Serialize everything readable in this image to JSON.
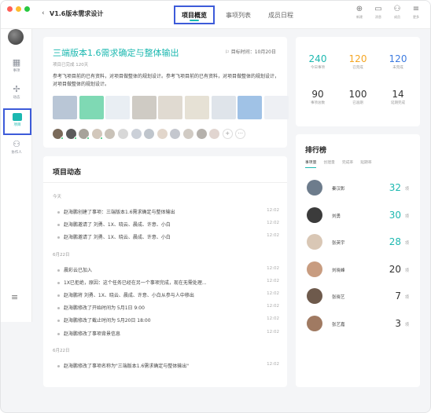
{
  "window": {
    "back_glyph": "‹",
    "project_title": "V1.6版本需求设计"
  },
  "tabs": [
    {
      "label": "项目概览",
      "active": true
    },
    {
      "label": "事项列表",
      "active": false
    },
    {
      "label": "成员日程",
      "active": false
    }
  ],
  "top_actions": [
    {
      "icon": "plus-circle-icon",
      "glyph": "⊕",
      "label": "新建"
    },
    {
      "icon": "message-icon",
      "glyph": "▭",
      "label": "消息"
    },
    {
      "icon": "user-icon",
      "glyph": "⚇",
      "label": "成员"
    },
    {
      "icon": "menu-icon",
      "glyph": "≡",
      "label": "更多"
    }
  ],
  "sidebar": {
    "items": [
      {
        "icon": "calendar-icon",
        "glyph": "▦",
        "label": "事项"
      },
      {
        "icon": "activity-icon",
        "glyph": "✢",
        "label": "动态"
      },
      {
        "icon": "folder-icon",
        "glyph": "",
        "label": "项目"
      },
      {
        "icon": "collaborator-icon",
        "glyph": "⚇",
        "label": "协作人"
      }
    ],
    "menu_glyph": "≡"
  },
  "project": {
    "name": "三端版本1.6需求确定与整体输出",
    "deadline": "目标时间：10月20日",
    "deadline_glyph": "⚐",
    "sub": "项目已完成 120天",
    "description": "参考飞项目前的已有资料，对项目做整体的规划设计。参考飞项目前的已有资料，对项目做整体的规划设计，对项目做整体的规划设计。",
    "thumb_colors": [
      "#b9c6d6",
      "#7fd9b4",
      "#e9eef3",
      "#cfcbc4",
      "#e0dad1",
      "#e6e1d5",
      "#dfe4ea",
      "#a0c2e6",
      "#eef0f4"
    ],
    "member_colors": [
      "#7a6a5a",
      "#5b5b5b",
      "#a7a29a",
      "#d2c7bb",
      "#c9c2b8",
      "#d8d8d8",
      "#cbd0d8",
      "#bfc5cc",
      "#e2d6cb",
      "#c4c7ce",
      "#d1cbc4",
      "#b5b1ac",
      "#e1d5d0"
    ],
    "member_add_glyph": "+",
    "member_more_glyph": "···"
  },
  "stats": [
    {
      "value": "240",
      "label": "今日事项",
      "color": "#1cb8b0"
    },
    {
      "value": "120",
      "label": "已完成",
      "color": "#f5a623"
    },
    {
      "value": "120",
      "label": "未完成",
      "color": "#3d7be0"
    },
    {
      "value": "90",
      "label": "事项总数",
      "color": "#333333"
    },
    {
      "value": "100",
      "label": "已逾期",
      "color": "#333333"
    },
    {
      "value": "14",
      "label": "延期完成",
      "color": "#333333"
    }
  ],
  "activity": {
    "title": "项目动态",
    "groups": [
      {
        "label": "今天",
        "rows": [
          {
            "text": "赵海鹏创建了事项：三端版本1.6需求确定与整体输出",
            "time": "12:02"
          },
          {
            "text": "赵海鹏邀请了 刘勇、1X、晓云、晨成、许意、小白",
            "time": "12:02"
          },
          {
            "text": "赵海鹏邀请了 刘勇、1X、晓云、晨成、许意、小白",
            "time": "12:02"
          }
        ]
      },
      {
        "label": "6月22日",
        "rows": [
          {
            "text": "晨彩云已加入",
            "time": "12:02"
          },
          {
            "text": "1X已拒绝，原因：这个任务已经在另一个事项完成，现在无需处理...",
            "time": "12:02"
          },
          {
            "text": "赵海鹏将 刘勇、1X、晓云、晨成、许意、小白从参与人中移出",
            "time": "12:02"
          },
          {
            "text": "赵海鹏修改了开始时间为 5月1日 9:00",
            "time": "12:02"
          },
          {
            "text": "赵海鹏修改了截止时间为 5月20日 18:00",
            "time": "12:02"
          },
          {
            "text": "赵海鹏修改了事项背景信息",
            "time": "12:02"
          }
        ]
      },
      {
        "label": "6月22日",
        "rows": [
          {
            "text": "赵海鹏修改了事项名称为\"三端版本1.6需求确定与整体输出\"",
            "time": "12:02"
          }
        ]
      }
    ]
  },
  "ranking": {
    "title": "排行榜",
    "tabs": [
      {
        "label": "事项量",
        "active": true
      },
      {
        "label": "创建量",
        "active": false
      },
      {
        "label": "完成率",
        "active": false
      },
      {
        "label": "延期率",
        "active": false
      }
    ],
    "rows": [
      {
        "name": "秦汉彰",
        "value": "32",
        "unit": "项",
        "color": "#1cb8b0",
        "avatar": "#6d7c8c"
      },
      {
        "name": "刘勇",
        "value": "30",
        "unit": "项",
        "color": "#1cb8b0",
        "avatar": "#3b3b3b"
      },
      {
        "name": "张英宇",
        "value": "28",
        "unit": "项",
        "color": "#1cb8b0",
        "avatar": "#d9c7b5"
      },
      {
        "name": "刘晓峰",
        "value": "20",
        "unit": "项",
        "color": "#333333",
        "avatar": "#c89c80"
      },
      {
        "name": "张晓艺",
        "value": "7",
        "unit": "项",
        "color": "#333333",
        "avatar": "#6e5a4c"
      },
      {
        "name": "张艺嘉",
        "value": "3",
        "unit": "项",
        "color": "#333333",
        "avatar": "#a07a62"
      }
    ]
  }
}
